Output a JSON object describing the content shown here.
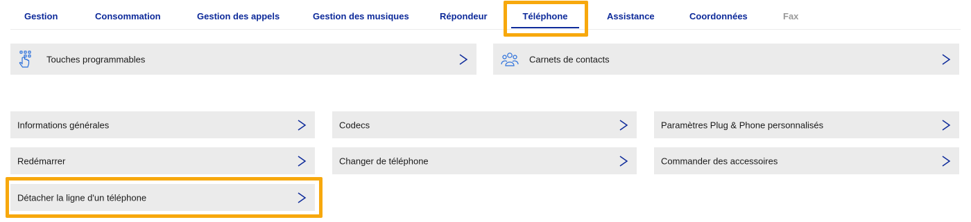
{
  "tabs": [
    {
      "label": "Gestion",
      "active": false
    },
    {
      "label": "Consommation",
      "active": false
    },
    {
      "label": "Gestion des appels",
      "active": false
    },
    {
      "label": "Gestion des musiques",
      "active": false
    },
    {
      "label": "Répondeur",
      "active": false
    },
    {
      "label": "Téléphone",
      "active": true
    },
    {
      "label": "Assistance",
      "active": false
    },
    {
      "label": "Coordonnées",
      "active": false
    },
    {
      "label": "Fax",
      "active": false,
      "disabled": true
    }
  ],
  "top_cards": [
    {
      "label": "Touches programmables",
      "icon": "keypad-touch-icon"
    },
    {
      "label": "Carnets de contacts",
      "icon": "contacts-group-icon"
    }
  ],
  "grid_cards": [
    {
      "label": "Informations générales"
    },
    {
      "label": "Codecs"
    },
    {
      "label": "Paramètres Plug & Phone personnalisés"
    },
    {
      "label": "Redémarrer"
    },
    {
      "label": "Changer de téléphone"
    },
    {
      "label": "Commander des accessoires"
    },
    {
      "label": "Détacher la ligne d'un téléphone"
    }
  ],
  "colors": {
    "accent": "#0d2a9a",
    "highlight": "#f7a80d",
    "card_bg": "#ebebeb",
    "disabled": "#9a9a9a"
  }
}
